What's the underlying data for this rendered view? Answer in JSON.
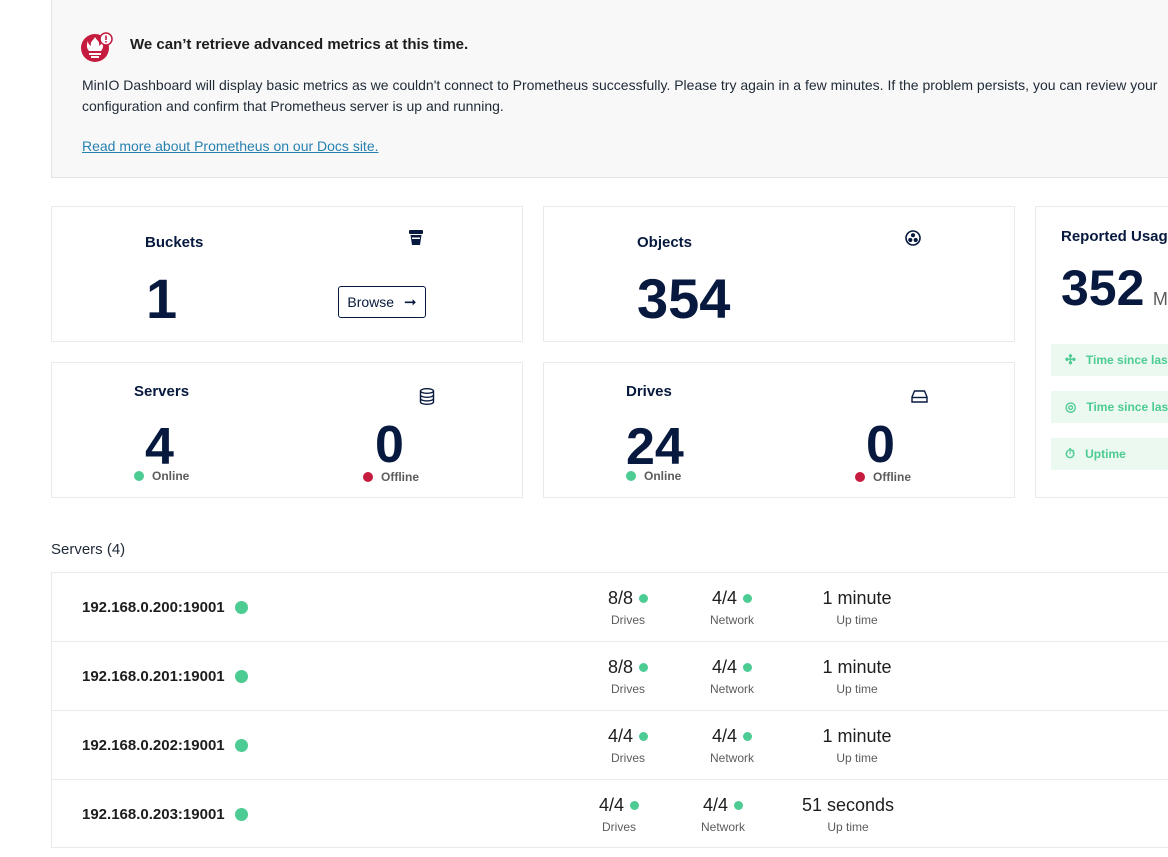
{
  "alert": {
    "title": "We can’t retrieve advanced metrics at this time.",
    "message": "MinIO Dashboard will display basic metrics as we couldn't connect to Prometheus successfully. Please try again in a few minutes. If the problem persists, you can review your configuration and confirm that Prometheus server is up and running.",
    "link": "Read more about Prometheus on our Docs site."
  },
  "buckets": {
    "title": "Buckets",
    "value": "1",
    "browse_label": "Browse"
  },
  "objects": {
    "title": "Objects",
    "value": "354"
  },
  "usage": {
    "title": "Reported Usage",
    "value": "352",
    "unit": "MiB",
    "rows": [
      "Time since last Heal Activity",
      "Time since last Scan Activity",
      "Uptime"
    ]
  },
  "servers_card": {
    "title": "Servers",
    "online_value": "4",
    "online_label": "Online",
    "offline_value": "0",
    "offline_label": "Offline"
  },
  "drives_card": {
    "title": "Drives",
    "online_value": "24",
    "online_label": "Online",
    "offline_value": "0",
    "offline_label": "Offline"
  },
  "server_list": {
    "title": "Servers (4)",
    "drives_label": "Drives",
    "network_label": "Network",
    "uptime_label": "Up time",
    "rows": [
      {
        "endpoint": "192.168.0.200:19001",
        "drives": "8/8",
        "network": "4/4",
        "uptime": "1 minute"
      },
      {
        "endpoint": "192.168.0.201:19001",
        "drives": "8/8",
        "network": "4/4",
        "uptime": "1 minute"
      },
      {
        "endpoint": "192.168.0.202:19001",
        "drives": "4/4",
        "network": "4/4",
        "uptime": "1 minute"
      },
      {
        "endpoint": "192.168.0.203:19001",
        "drives": "4/4",
        "network": "4/4",
        "uptime": "51 seconds"
      }
    ]
  },
  "colors": {
    "online": "#4ccb92",
    "offline": "#c51b3f",
    "primary": "#07193e",
    "link": "#2781b0"
  }
}
